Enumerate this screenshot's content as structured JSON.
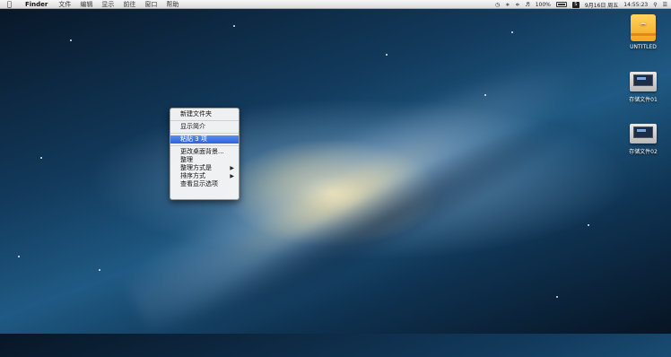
{
  "menubar": {
    "apple_icon": "apple-icon",
    "app_name": "Finder",
    "menus": [
      "文件",
      "编辑",
      "显示",
      "前往",
      "窗口",
      "帮助"
    ],
    "battery": "100%",
    "date": "9月16日 周五",
    "time": "14:55:23"
  },
  "desktop": {
    "icons": [
      {
        "label": "UNTITLED",
        "icon": "usb-drive-icon"
      },
      {
        "label": "存储文件01",
        "icon": "disk-image-icon"
      },
      {
        "label": "存储文件02",
        "icon": "disk-image-icon"
      }
    ]
  },
  "context_menu": {
    "items": [
      {
        "label": "新建文件夹"
      },
      {
        "label": "显示简介"
      },
      {
        "label": "粘贴 3 项",
        "selected": true
      },
      {
        "label": "更改桌面背景..."
      },
      {
        "label": "整理"
      },
      {
        "label": "整理方式是",
        "submenu": true
      },
      {
        "label": "排序方式",
        "submenu": true
      },
      {
        "label": "查看显示选项"
      }
    ],
    "highlight_color": "#3a6fe0"
  }
}
